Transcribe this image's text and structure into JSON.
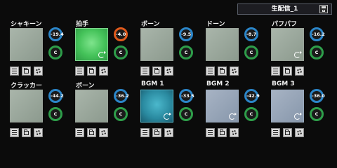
{
  "header": {
    "preset_name": "生配信_1",
    "save_icon": "floppy-disk-icon"
  },
  "colors": {
    "background": "#0b0b0b",
    "volume_ring": "#2b86c9",
    "volume_ring_hot": "#e05a1c",
    "pan_ring": "#2e9e4a",
    "pad_active": "#45c35a",
    "pad_bgm": "#2a8aa0"
  },
  "pads": [
    {
      "title": "シャキーン",
      "volume": "-19.4",
      "pan": "C",
      "state": "idle",
      "loop": false,
      "volume_hot": false
    },
    {
      "title": "拍手",
      "volume": "-4.0",
      "pan": "C",
      "state": "playing",
      "loop": true,
      "volume_hot": true
    },
    {
      "title": "ボーン",
      "volume": "-9.5",
      "pan": "C",
      "state": "idle",
      "loop": false,
      "volume_hot": false
    },
    {
      "title": "ドーン",
      "volume": "-8.7",
      "pan": "C",
      "state": "idle",
      "loop": false,
      "volume_hot": false
    },
    {
      "title": "パフパフ",
      "volume": "-16.2",
      "pan": "C",
      "state": "idle",
      "loop": true,
      "volume_hot": false
    },
    {
      "title": "クラッカー",
      "volume": "-44.2",
      "pan": "C",
      "state": "idle",
      "loop": false,
      "volume_hot": false
    },
    {
      "title": "ボーン",
      "volume": "-36.2",
      "pan": "C",
      "state": "idle",
      "loop": false,
      "volume_hot": false
    },
    {
      "title": "BGM 1",
      "volume": "-33.5",
      "pan": "C",
      "state": "playing",
      "loop": true,
      "volume_hot": false
    },
    {
      "title": "BGM 2",
      "volume": "-42.9",
      "pan": "C",
      "state": "idle",
      "loop": true,
      "volume_hot": false
    },
    {
      "title": "BGM 3",
      "volume": "-36.0",
      "pan": "C",
      "state": "idle",
      "loop": true,
      "volume_hot": false
    }
  ],
  "pad_buttons": [
    "menu-icon",
    "folder-icon",
    "gear-icon"
  ]
}
